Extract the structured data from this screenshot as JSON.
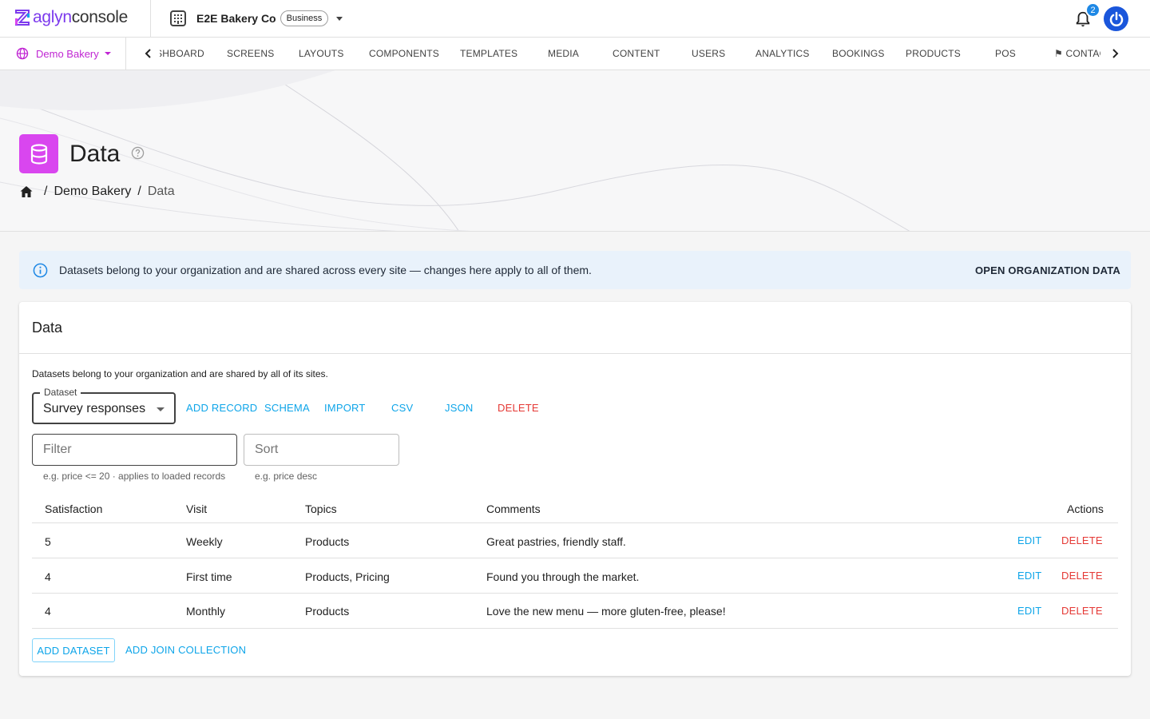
{
  "app": {
    "logo_brand": "aglyn",
    "logo_suffix": "console",
    "org_name": "E2E Bakery Co",
    "org_badge": "Business",
    "notification_count": "2",
    "brand_color": "#7c3aed",
    "accent_color": "#0ea5e9",
    "danger_color": "#e53935"
  },
  "nav": {
    "site_name": "Demo Bakery",
    "tabs": [
      "DASHBOARD",
      "SCREENS",
      "LAYOUTS",
      "COMPONENTS",
      "TEMPLATES",
      "MEDIA",
      "CONTENT",
      "USERS",
      "ANALYTICS",
      "BOOKINGS",
      "PRODUCTS",
      "POS",
      "⚑ CONTACT"
    ]
  },
  "header": {
    "title": "Data",
    "breadcrumb": [
      "Demo Bakery",
      "Data"
    ],
    "icon": "database-icon"
  },
  "banner": {
    "text": "Datasets belong to your organization and are shared across every site — changes here apply to all of them.",
    "action": "OPEN ORGANIZATION DATA"
  },
  "card": {
    "title": "Data",
    "description": "Datasets belong to your organization and are shared by all of its sites.",
    "dataset_label": "Dataset",
    "dataset_value": "Survey responses",
    "toolbar": {
      "add_record": "ADD RECORD",
      "schema": "SCHEMA",
      "import": "IMPORT",
      "csv": "CSV",
      "json": "JSON",
      "delete": "DELETE"
    },
    "filter": {
      "placeholder": "Filter",
      "hint": "e.g. price <= 20 · applies to loaded records"
    },
    "sort": {
      "placeholder": "Sort",
      "hint": "e.g. price desc"
    },
    "table": {
      "columns": [
        "Satisfaction",
        "Visit",
        "Topics",
        "Comments",
        "Actions"
      ],
      "rows": [
        {
          "satisfaction": "5",
          "visit": "Weekly",
          "topics": "Products",
          "comments": "Great pastries, friendly staff.",
          "edit": "EDIT",
          "delete": "DELETE"
        },
        {
          "satisfaction": "4",
          "visit": "First time",
          "topics": "Products, Pricing",
          "comments": "Found you through the market.",
          "edit": "EDIT",
          "delete": "DELETE"
        },
        {
          "satisfaction": "4",
          "visit": "Monthly",
          "topics": "Products",
          "comments": "Love the new menu — more gluten-free, please!",
          "edit": "EDIT",
          "delete": "DELETE"
        }
      ]
    },
    "add_dataset": "ADD DATASET",
    "add_join": "ADD JOIN COLLECTION"
  }
}
